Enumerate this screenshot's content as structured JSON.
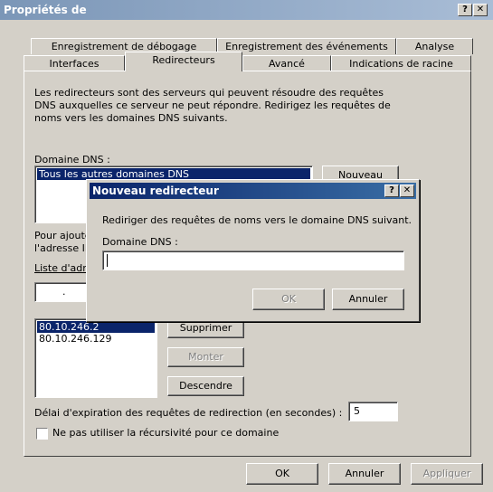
{
  "window": {
    "title": "Propriétés de"
  },
  "title_buttons": {
    "help": "?",
    "close": "✕"
  },
  "tabs": {
    "row1": [
      "Enregistrement de débogage",
      "Enregistrement des événements",
      "Analyse"
    ],
    "row2": [
      "Interfaces",
      "Redirecteurs",
      "Avancé",
      "Indications de racine"
    ]
  },
  "main": {
    "description": [
      "Les redirecteurs sont des serveurs qui peuvent résoudre des requêtes",
      "DNS auxquelles ce serveur ne peut répondre. Redirigez les requêtes de",
      "noms vers les domaines DNS suivants."
    ],
    "domain_label": "Domaine DNS :",
    "domain_item": "Tous les autres domaines DNS",
    "new_button": "Nouveau",
    "add_text_1": "Pour ajouter",
    "add_text_2": "l'adresse IP",
    "ip_list_label": "Liste d'adresses",
    "ip_dot": ".",
    "ip_items": [
      "80.10.246.2",
      "80.10.246.129"
    ],
    "delete_button": "Supprimer",
    "up_button": "Monter",
    "down_button": "Descendre",
    "timeout_label": "Délai d'expiration des requêtes de redirection (en secondes) :",
    "timeout_value": "5",
    "no_recursion_label": "Ne pas utiliser la récursivité pour ce domaine"
  },
  "footer": {
    "ok": "OK",
    "cancel": "Annuler",
    "apply": "Appliquer"
  },
  "dialog": {
    "title": "Nouveau redirecteur",
    "help": "?",
    "close": "✕",
    "instruction": "Rediriger des requêtes de noms vers le domaine DNS suivant.",
    "domain_label": "Domaine DNS :",
    "domain_value": "",
    "ok": "OK",
    "cancel": "Annuler"
  }
}
